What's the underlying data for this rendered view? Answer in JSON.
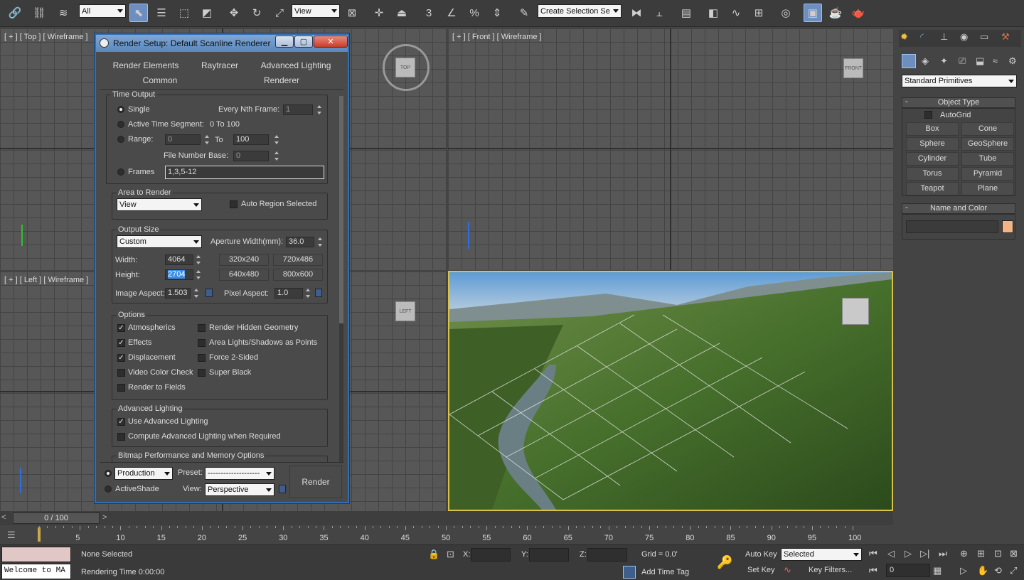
{
  "toolbar": {
    "filter_select": "All",
    "ref_coord_select": "View",
    "selection_set": "Create Selection Se",
    "snap_values": [
      "3",
      "%"
    ]
  },
  "viewports": {
    "top": {
      "label": "[ + ] [ Top ] [ Wireframe ]",
      "gizmo": "TOP"
    },
    "front": {
      "label": "[ + ] [ Front ] [ Wireframe ]",
      "gizmo": "FRONT"
    },
    "left": {
      "label": "[ + ] [ Left ] [ Wireframe ]",
      "gizmo": "LEFT"
    }
  },
  "dialog": {
    "title": "Render Setup: Default Scanline Renderer",
    "tabs_row1": [
      "Render Elements",
      "Raytracer",
      "Advanced Lighting"
    ],
    "tabs_row2": [
      "Common",
      "Renderer"
    ],
    "time_output": {
      "group_title": "Time Output",
      "single": "Single",
      "every_nth": "Every Nth Frame:",
      "every_nth_value": "1",
      "active_segment": "Active Time Segment:",
      "active_segment_value": "0 To 100",
      "range": "Range:",
      "range_from": "0",
      "range_to_label": "To",
      "range_to": "100",
      "file_number_base": "File Number Base:",
      "file_number_base_value": "0",
      "frames": "Frames",
      "frames_value": "1,3,5-12"
    },
    "area_to_render": {
      "group_title": "Area to Render",
      "select": "View",
      "auto_region": "Auto Region Selected"
    },
    "output_size": {
      "group_title": "Output Size",
      "select": "Custom",
      "aperture_label": "Aperture Width(mm):",
      "aperture_value": "36.0",
      "width_label": "Width:",
      "width_value": "4064",
      "height_label": "Height:",
      "height_value": "2704",
      "presets": [
        "320x240",
        "720x486",
        "640x480",
        "800x600"
      ],
      "image_aspect_label": "Image Aspect:",
      "image_aspect_value": "1.503",
      "pixel_aspect_label": "Pixel Aspect:",
      "pixel_aspect_value": "1.0"
    },
    "options": {
      "group_title": "Options",
      "items": [
        {
          "label": "Atmospherics",
          "checked": true
        },
        {
          "label": "Render Hidden Geometry",
          "checked": false
        },
        {
          "label": "Effects",
          "checked": true
        },
        {
          "label": "Area Lights/Shadows as Points",
          "checked": false
        },
        {
          "label": "Displacement",
          "checked": true
        },
        {
          "label": "Force 2-Sided",
          "checked": false
        },
        {
          "label": "Video Color Check",
          "checked": false
        },
        {
          "label": "Super Black",
          "checked": false
        },
        {
          "label": "Render to Fields",
          "checked": false
        }
      ]
    },
    "advanced_lighting": {
      "group_title": "Advanced Lighting",
      "use": "Use Advanced Lighting",
      "compute": "Compute Advanced Lighting when Required"
    },
    "bitmap_group_title": "Bitmap Performance and Memory Options",
    "footer": {
      "mode_select": "Production",
      "activeshade": "ActiveShade",
      "preset_label": "Preset:",
      "preset_value": "--------------------",
      "view_label": "View:",
      "view_value": "Perspective",
      "render_button": "Render"
    }
  },
  "command_panel": {
    "category_select": "Standard Primitives",
    "object_type_title": "Object Type",
    "autogrid": "AutoGrid",
    "buttons": [
      "Box",
      "Cone",
      "Sphere",
      "GeoSphere",
      "Cylinder",
      "Tube",
      "Torus",
      "Pyramid",
      "Teapot",
      "Plane"
    ],
    "name_color_title": "Name and Color",
    "color_swatch": "#f4b483"
  },
  "timeline": {
    "frame_counter": "0 / 100",
    "ticks": [
      "5",
      "10",
      "15",
      "20",
      "25",
      "30",
      "35",
      "40",
      "45",
      "50",
      "55",
      "60",
      "65",
      "70",
      "75",
      "80",
      "85",
      "90",
      "95",
      "100"
    ]
  },
  "status": {
    "maxscript": "Welcome to MA",
    "selection": "None Selected",
    "rendering_time": "Rendering Time  0:00:00",
    "x_label": "X:",
    "y_label": "Y:",
    "z_label": "Z:",
    "grid": "Grid = 0.0'",
    "add_time_tag": "Add Time Tag",
    "auto_key": "Auto Key",
    "set_key": "Set Key",
    "key_select": "Selected",
    "key_filters": "Key Filters...",
    "current_frame": "0"
  }
}
